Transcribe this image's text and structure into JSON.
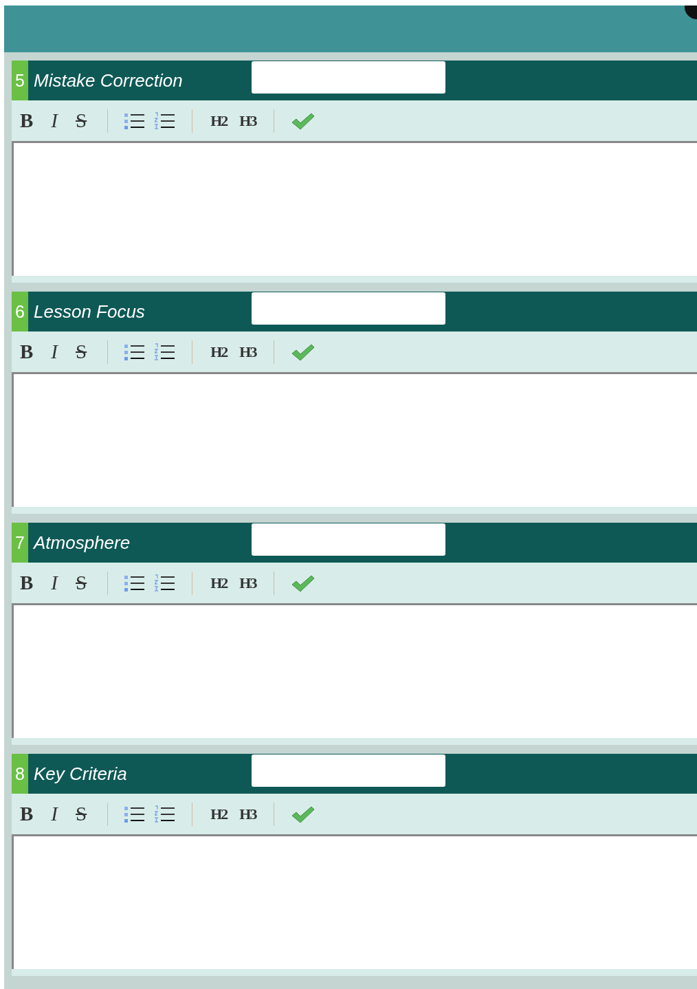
{
  "sections": [
    {
      "number": "5",
      "title": "Mistake Correction",
      "toolbar": [
        "B",
        "I",
        "S",
        "H2",
        "H3"
      ]
    },
    {
      "number": "6",
      "title": "Lesson Focus",
      "toolbar": [
        "B",
        "I",
        "S",
        "H2",
        "H3"
      ]
    },
    {
      "number": "7",
      "title": "Atmosphere",
      "toolbar": [
        "B",
        "I",
        "S",
        "H2",
        "H3"
      ]
    },
    {
      "number": "8",
      "title": "Key Criteria",
      "toolbar": [
        "B",
        "I",
        "S",
        "H2",
        "H3"
      ]
    }
  ]
}
